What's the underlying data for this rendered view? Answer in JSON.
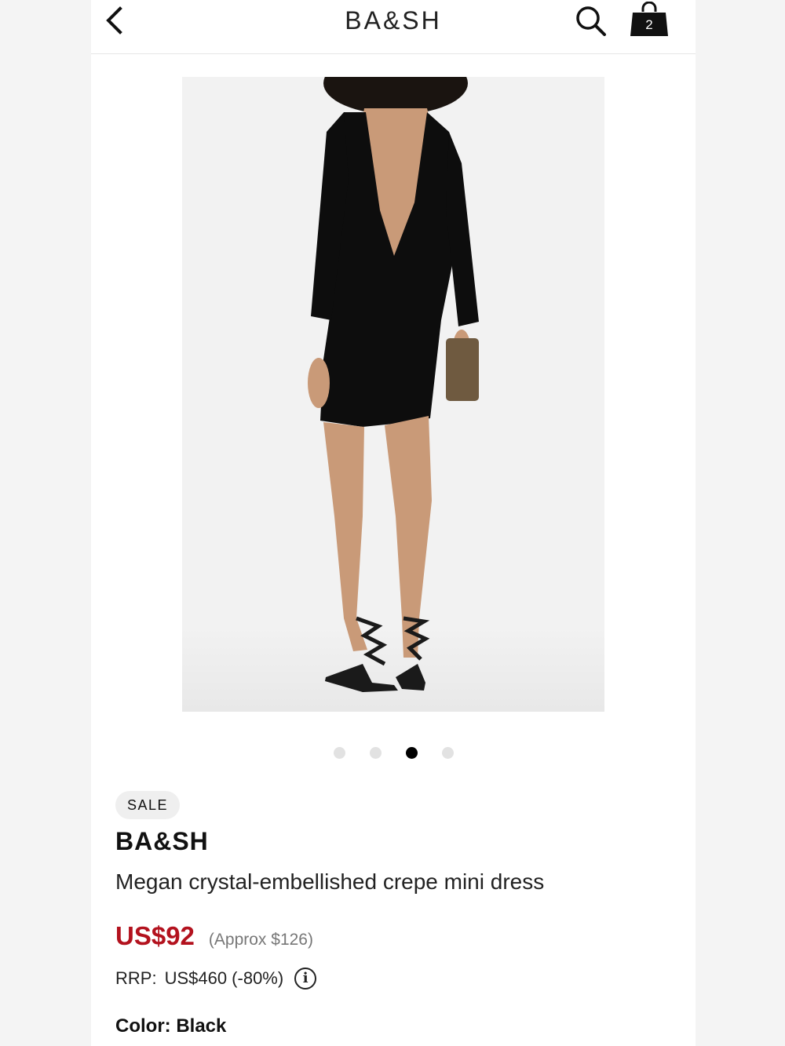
{
  "header": {
    "title": "BA&SH",
    "back_icon": "chevron-left-icon",
    "search_icon": "search-icon",
    "bag_icon": "shopping-bag-icon",
    "bag_count": "2"
  },
  "product_image": {
    "alt": "Megan crystal-embellished crepe mini dress",
    "dress_color": "#0d0d0d",
    "skin_color": "#c99a78",
    "clutch_color": "#6f5a40"
  },
  "carousel": {
    "total": 4,
    "active_index": 2
  },
  "product": {
    "badge": "SALE",
    "brand": "BA&SH",
    "name": "Megan crystal-embellished crepe mini dress",
    "price": "US$92",
    "approx": "(Approx $126)",
    "rrp_label": "RRP:",
    "rrp_value": "US$460 (-80%)",
    "info_icon": "info-icon",
    "color_label": "Color:",
    "color_value": "Black"
  },
  "colors": {
    "sale_price": "#b3121e",
    "approx_text": "#777777",
    "badge_bg": "#efefef"
  }
}
